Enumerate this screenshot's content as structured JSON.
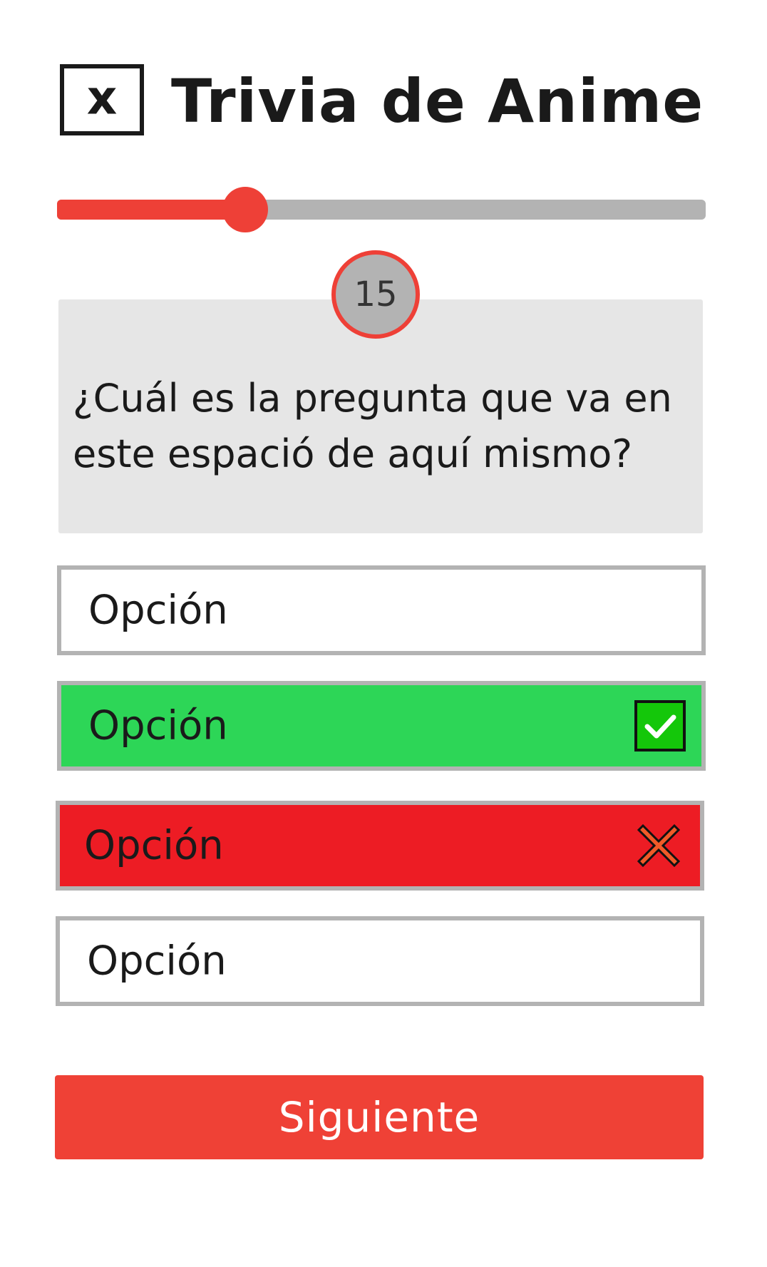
{
  "header": {
    "logo_icon": "x-box-icon",
    "logo_glyph": "x",
    "title": "Trivia de Anime"
  },
  "progress": {
    "fraction": 0.29
  },
  "timer": {
    "value": "15"
  },
  "question": {
    "text": "¿Cuál es la pregunta que va en este espació de aquí mismo?"
  },
  "options": [
    {
      "label": "Opción",
      "state": "default"
    },
    {
      "label": "Opción",
      "state": "correct",
      "icon": "check-icon"
    },
    {
      "label": "Opción",
      "state": "wrong",
      "icon": "x-mark-icon"
    },
    {
      "label": "Opción",
      "state": "default"
    }
  ],
  "next_button": {
    "label": "Siguiente"
  },
  "colors": {
    "accent": "#ef4136",
    "correct": "#2dd657",
    "wrong": "#ed1c24",
    "track": "#b3b3b3",
    "card": "#e6e6e6"
  }
}
